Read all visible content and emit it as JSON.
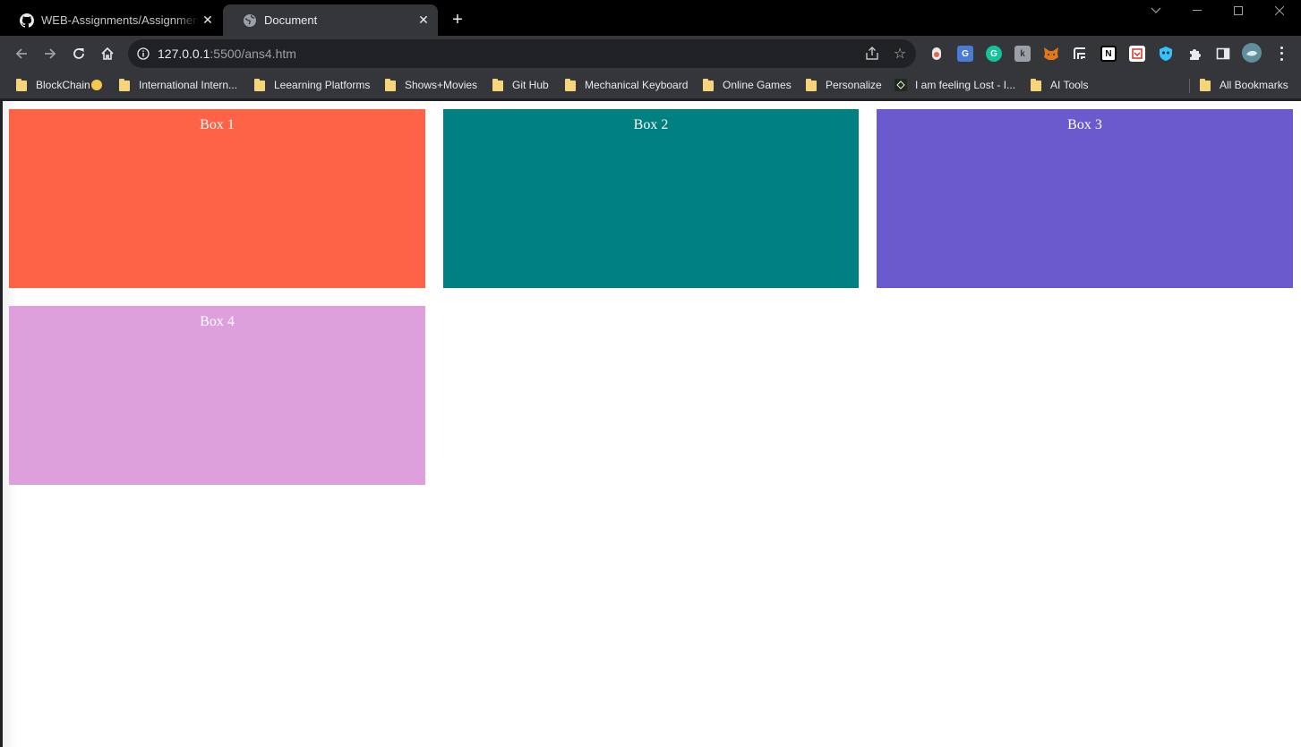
{
  "tabs": [
    {
      "title": "WEB-Assignments/Assignment 1",
      "icon": "github-icon"
    },
    {
      "title": "Document",
      "icon": "globe-icon",
      "active": true
    }
  ],
  "address_bar": {
    "host": "127.0.0.1",
    "rest": ":5500/ans4.htm"
  },
  "bookmarks": [
    {
      "label": "BlockChain",
      "icon": "folder-icon",
      "emoji": true
    },
    {
      "label": "International Intern...",
      "icon": "folder-icon"
    },
    {
      "label": "Leearning Platforms",
      "icon": "folder-icon"
    },
    {
      "label": "Shows+Movies",
      "icon": "folder-icon"
    },
    {
      "label": "Git Hub",
      "icon": "folder-icon"
    },
    {
      "label": "Mechanical Keyboard",
      "icon": "folder-icon"
    },
    {
      "label": "Online Games",
      "icon": "folder-icon"
    },
    {
      "label": "Personalize",
      "icon": "folder-icon"
    },
    {
      "label": "I am feeling Lost - I...",
      "icon": "site-icon"
    },
    {
      "label": "AI Tools",
      "icon": "folder-icon"
    }
  ],
  "all_bookmarks": "All Bookmarks",
  "extensions": [
    {
      "name": "record-extension-icon",
      "color": "#e8eaed"
    },
    {
      "name": "google-translate-icon",
      "color": "#4a7bd6"
    },
    {
      "name": "grammarly-icon",
      "color": "#15c39a"
    },
    {
      "name": "extension-k-icon",
      "color": "#9aa0a6"
    },
    {
      "name": "metamask-icon",
      "color": "#e2761b"
    },
    {
      "name": "extension-f-icon",
      "color": "#e8eaed"
    },
    {
      "name": "notion-icon",
      "color": "#ffffff"
    },
    {
      "name": "pdf-icon",
      "color": "#e8eaed"
    },
    {
      "name": "vpn-shield-icon",
      "color": "#35c2ff"
    }
  ],
  "boxes": [
    {
      "label": "Box 1",
      "color": "#ff6347"
    },
    {
      "label": "Box 2",
      "color": "#008080"
    },
    {
      "label": "Box 3",
      "color": "#6a5acd"
    },
    {
      "label": "Box 4",
      "color": "#dda0dd"
    }
  ]
}
